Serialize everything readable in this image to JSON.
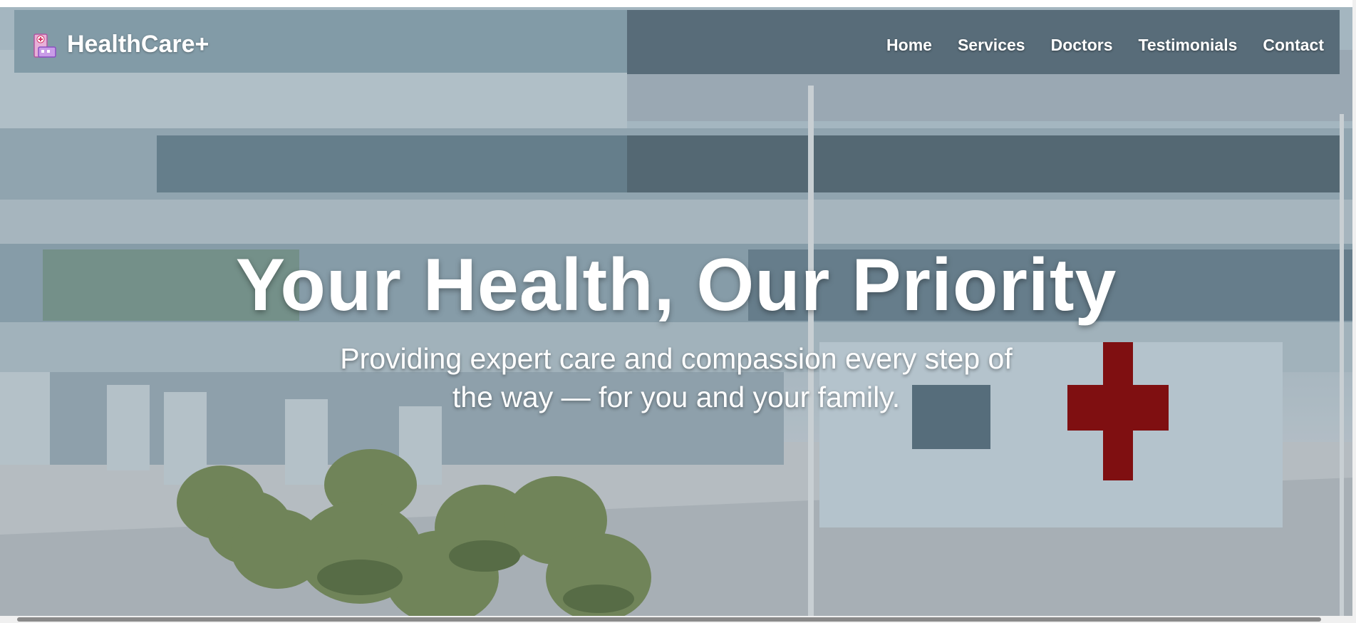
{
  "brand": {
    "name": "HealthCare+",
    "icon": "hospital-icon"
  },
  "nav": {
    "items": [
      {
        "label": "Home"
      },
      {
        "label": "Services"
      },
      {
        "label": "Doctors"
      },
      {
        "label": "Testimonials"
      },
      {
        "label": "Contact"
      }
    ]
  },
  "hero": {
    "title": "Your Health, Our Priority",
    "subtitle": "Providing expert care and compassion every step of the way — for you and your family.",
    "image": "hospital-building-image"
  },
  "colors": {
    "text": "#ffffff",
    "cross": "#8b0a0a",
    "building": "#c8d6de"
  }
}
